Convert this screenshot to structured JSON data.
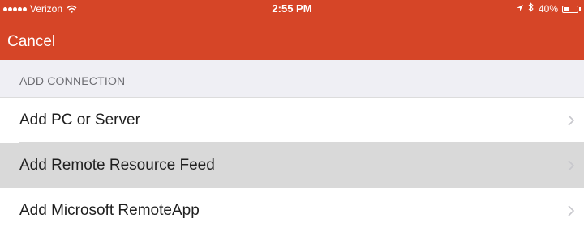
{
  "status_bar": {
    "carrier": "Verizon",
    "time": "2:55 PM",
    "battery": "40%",
    "battery_level": 0.4
  },
  "nav": {
    "cancel_label": "Cancel"
  },
  "section": {
    "header": "ADD CONNECTION"
  },
  "items": [
    {
      "label": "Add PC or Server",
      "selected": false
    },
    {
      "label": "Add Remote Resource Feed",
      "selected": true
    },
    {
      "label": "Add Microsoft RemoteApp",
      "selected": false
    }
  ],
  "colors": {
    "accent": "#d64527",
    "selected_row": "#d9d9d9",
    "section_bg": "#efeff4"
  },
  "icons": {
    "signal": "signal-dots-icon",
    "wifi": "wifi-icon",
    "location": "location-arrow-icon",
    "bluetooth": "bluetooth-icon",
    "battery": "battery-icon",
    "chevron": "chevron-right-icon"
  }
}
